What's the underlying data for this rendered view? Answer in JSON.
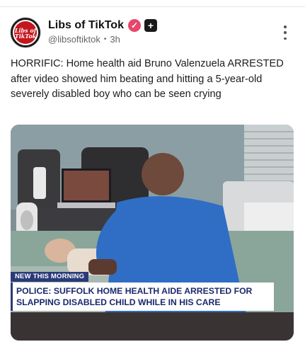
{
  "account": {
    "display_name": "Libs of TikTok",
    "handle": "@libsoftiktok",
    "separator": "•",
    "time_ago": "3h",
    "avatar_text": [
      "Libs of",
      "TikTok"
    ],
    "verified_badge_glyph": "✓",
    "plus_badge_glyph": "+"
  },
  "post": {
    "text": "HORRIFIC: Home health aid Bruno Valenzuela ARRESTED after video showed him beating and hitting a 5-year-old severely disabled boy who can be seen crying"
  },
  "media": {
    "kind": "video-still",
    "tag": "NEW THIS MORNING",
    "headline_line1": "POLICE: SUFFOLK HOME HEALTH AIDE ARRESTED FOR",
    "headline_line2": "SLAPPING DISABLED CHILD WHILE IN HIS CARE"
  },
  "icons": {
    "more": "more-vertical-icon",
    "verified": "verified-badge-icon",
    "plus": "plus-badge-icon"
  },
  "colors": {
    "verified": "#e8466a",
    "banner_text": "#1a2a6b",
    "tag_bg": "#2a3b78"
  }
}
